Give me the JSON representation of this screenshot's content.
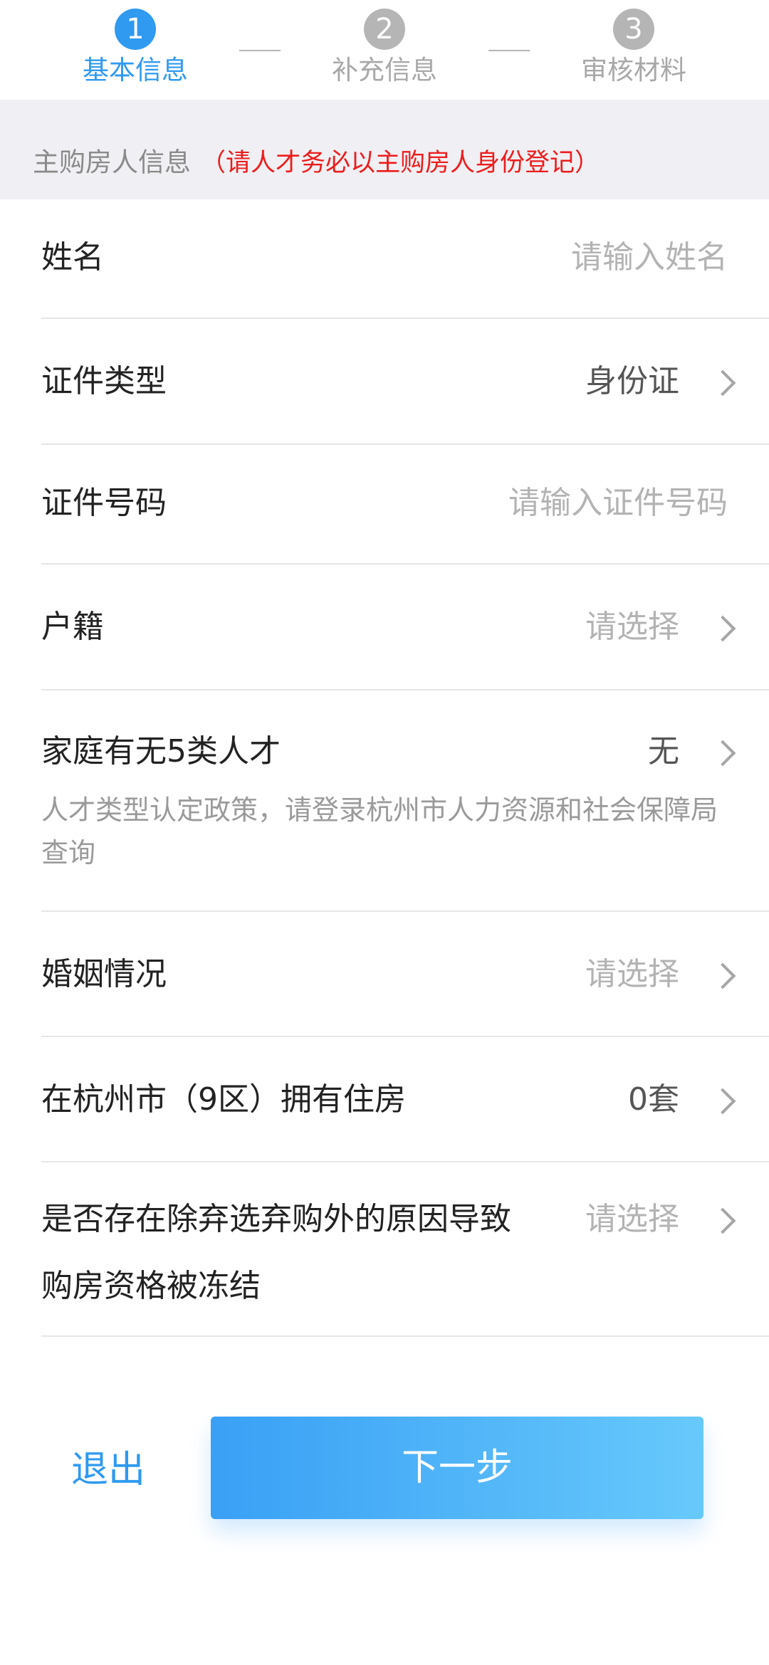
{
  "stepper": {
    "steps": [
      {
        "number": "1",
        "label": "基本信息",
        "state": "active"
      },
      {
        "number": "2",
        "label": "补充信息",
        "state": "inactive"
      },
      {
        "number": "3",
        "label": "审核材料",
        "state": "inactive"
      }
    ]
  },
  "section": {
    "title": "主购房人信息",
    "note": "（请人才务必以主购房人身份登记）"
  },
  "form": {
    "name": {
      "label": "姓名",
      "placeholder": "请输入姓名"
    },
    "id_type": {
      "label": "证件类型",
      "value": "身份证"
    },
    "id_number": {
      "label": "证件号码",
      "placeholder": "请输入证件号码"
    },
    "household": {
      "label": "户籍",
      "value": "请选择"
    },
    "talent": {
      "label": "家庭有无5类人才",
      "value": "无",
      "hint": "人才类型认定政策，请登录杭州市人力资源和社会保障局查询"
    },
    "marriage": {
      "label": "婚姻情况",
      "value": "请选择"
    },
    "housing": {
      "label": "在杭州市（9区）拥有住房",
      "value": "0套"
    },
    "frozen": {
      "label_line1": "是否存在除弃选弃购外的原因导致",
      "label_line2": "购房资格被冻结",
      "value": "请选择"
    }
  },
  "actions": {
    "exit_label": "退出",
    "next_label": "下一步"
  },
  "colors": {
    "accent": "#2f9af0",
    "warning": "#ee1c1c",
    "inactive": "#b5b5b5"
  }
}
